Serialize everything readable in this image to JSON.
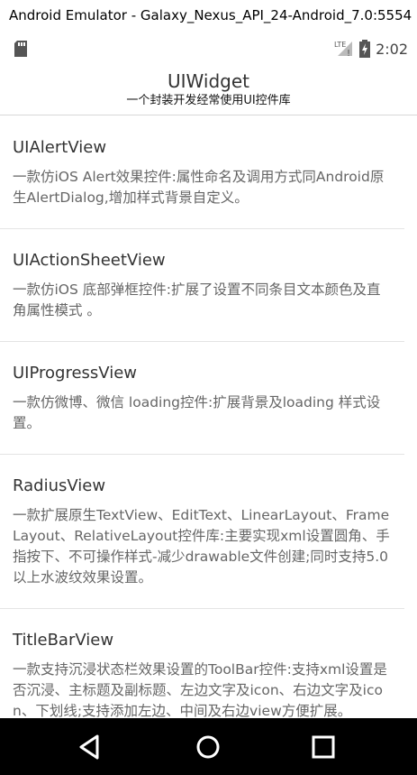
{
  "window": {
    "title": "Android Emulator - Galaxy_Nexus_API_24-Android_7.0:5554"
  },
  "statusbar": {
    "left_icon": "sd-card-icon",
    "network_label": "LTE",
    "clock": "2:02",
    "icons": [
      "signal-icon",
      "battery-charging-icon"
    ]
  },
  "appbar": {
    "title": "UIWidget",
    "subtitle": "一个封装开发经常使用UI控件库"
  },
  "items": [
    {
      "title": "UIAlertView",
      "desc": "一款仿iOS Alert效果控件:属性命名及调用方式同Android原生AlertDialog,增加样式背景自定义。"
    },
    {
      "title": "UIActionSheetView",
      "desc": "一款仿iOS 底部弹框控件:扩展了设置不同条目文本颜色及直角属性模式 。"
    },
    {
      "title": "UIProgressView",
      "desc": "一款仿微博、微信 loading控件:扩展背景及loading 样式设置。"
    },
    {
      "title": "RadiusView",
      "desc": "一款扩展原生TextView、EditText、LinearLayout、FrameLayout、RelativeLayout控件库:主要实现xml设置圆角、手指按下、不可操作样式-减少drawable文件创建;同时支持5.0以上水波纹效果设置。"
    },
    {
      "title": "TitleBarView",
      "desc": "一款支持沉浸状态栏效果设置的ToolBar控件:支持xml设置是否沉浸、主标题及副标题、左边文字及icon、右边文字及icon、下划线;支持添加左边、中间及右边view方便扩展。"
    }
  ],
  "navbar": {
    "buttons": [
      "back-icon",
      "home-icon",
      "recents-icon"
    ]
  }
}
